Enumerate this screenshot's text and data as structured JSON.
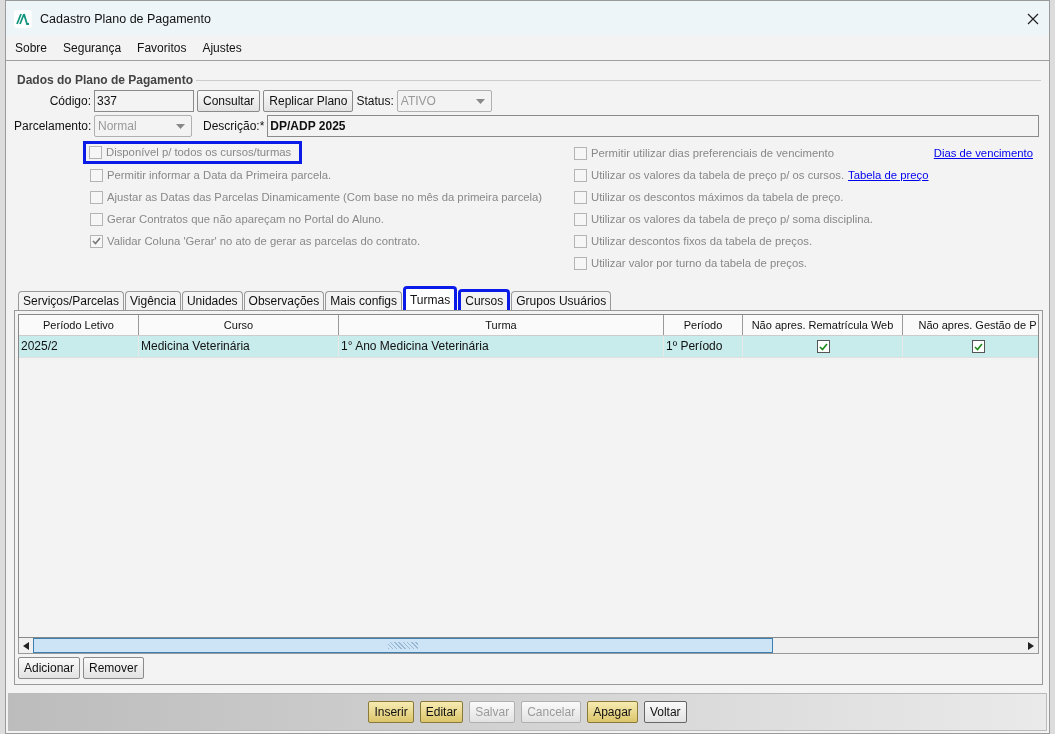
{
  "window": {
    "title": "Cadastro Plano de Pagamento"
  },
  "menu": [
    "Sobre",
    "Segurança",
    "Favoritos",
    "Ajustes"
  ],
  "group": {
    "title": "Dados do Plano de Pagamento",
    "codigo": {
      "label": "Código:",
      "value": "337"
    },
    "consultar": "Consultar",
    "replicar": "Replicar Plano",
    "status": {
      "label": "Status:",
      "value": "ATIVO",
      "disabled": true
    },
    "parcelamento": {
      "label": "Parcelamento:",
      "value": "Normal",
      "disabled": true
    },
    "descricao": {
      "label": "Descrição:*",
      "value": "DP/ADP 2025"
    }
  },
  "options_left": [
    {
      "label": "Disponível p/ todos os cursos/turmas",
      "checked": false,
      "highlighted": true
    },
    {
      "label": "Permitir informar a Data da Primeira parcela.",
      "checked": false,
      "highlighted": false
    },
    {
      "label": "Ajustar as Datas das Parcelas Dinamicamente (Com base no mês da primeira parcela)",
      "checked": false,
      "highlighted": false
    },
    {
      "label": "Gerar Contratos que não apareçam no Portal do Aluno.",
      "checked": false,
      "highlighted": false
    },
    {
      "label": "Validar Coluna 'Gerar' no ato de gerar as parcelas do contrato.",
      "checked": true,
      "highlighted": false
    }
  ],
  "options_right": [
    {
      "label": "Permitir utilizar dias preferenciais de vencimento",
      "checked": false,
      "link": "Dias de vencimento",
      "kind": "far_link"
    },
    {
      "label": "Utilizar os valores da tabela de preço p/ os cursos.",
      "checked": false,
      "link": "Tabela de preço",
      "kind": "inline_link"
    },
    {
      "label": "Utilizar os descontos máximos da tabela de preço.",
      "checked": false
    },
    {
      "label": "Utilizar os valores da tabela de preço p/ soma disciplina.",
      "checked": false
    },
    {
      "label": "Utilizar descontos fixos da tabela de preços.",
      "checked": false
    },
    {
      "label": "Utilizar valor por turno da tabela de preços.",
      "checked": false
    }
  ],
  "tabs": [
    {
      "label": "Serviços/Parcelas",
      "selected": false,
      "highlighted": false
    },
    {
      "label": "Vigência",
      "selected": false,
      "highlighted": false
    },
    {
      "label": "Unidades",
      "selected": false,
      "highlighted": false
    },
    {
      "label": "Observações",
      "selected": false,
      "highlighted": false
    },
    {
      "label": "Mais configs",
      "selected": false,
      "highlighted": false
    },
    {
      "label": "Turmas",
      "selected": true,
      "highlighted": true
    },
    {
      "label": "Cursos",
      "selected": false,
      "highlighted": true
    },
    {
      "label": "Grupos Usuários",
      "selected": false,
      "highlighted": false
    }
  ],
  "table": {
    "columns": [
      "Período Letivo",
      "Curso",
      "Turma",
      "Período",
      "Não apres. Rematrícula Web",
      "Não apres. Gestão de P"
    ],
    "rows": [
      {
        "selected": true,
        "cells": [
          {
            "kind": "text",
            "text": "2025/2"
          },
          {
            "kind": "text",
            "text": "Medicina Veterinária"
          },
          {
            "kind": "text",
            "text": "1°  Ano Medicina Veterinária"
          },
          {
            "kind": "text",
            "text": "1º Período"
          },
          {
            "kind": "check",
            "checked": true
          },
          {
            "kind": "check",
            "checked": true
          }
        ]
      }
    ]
  },
  "panel_buttons": [
    "Adicionar",
    "Remover"
  ],
  "footer_buttons": [
    {
      "label": "Inserir",
      "kind": "accent"
    },
    {
      "label": "Editar",
      "kind": "accent"
    },
    {
      "label": "Salvar",
      "kind": "disabled"
    },
    {
      "label": "Cancelar",
      "kind": "disabled"
    },
    {
      "label": "Apagar",
      "kind": "accent"
    },
    {
      "label": "Voltar",
      "kind": "plain"
    }
  ]
}
